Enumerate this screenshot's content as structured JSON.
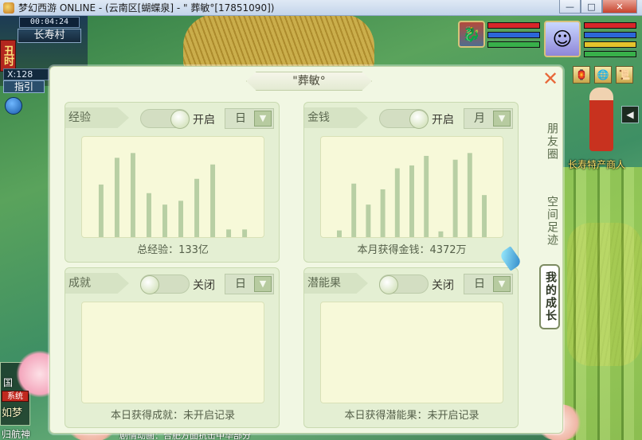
{
  "window": {
    "title": "梦幻西游 ONLINE - (云南区[蝴蝶泉] - \" 葬敏°[17851090])",
    "controls": [
      "—",
      "□",
      "✕"
    ]
  },
  "hud": {
    "time": "00:04:24",
    "location": "长寿村",
    "shichen": "丑时",
    "coord": "X:128",
    "guide": "指引",
    "npc_label": "长寿特产商人",
    "world_channel": "国",
    "system_tag": "系统",
    "chat_line1": "如梦",
    "chat_line2": "归航神",
    "chat_line3": "剧情动画：合肥方面抗击中华部分"
  },
  "panel": {
    "title": "\"葬敏°",
    "close_icon": "close-icon",
    "side_tabs": [
      {
        "label": "朋友圈",
        "active": false
      },
      {
        "label": "空间足迹",
        "active": false
      },
      {
        "label": "我的成长",
        "active": true
      }
    ],
    "cards": [
      {
        "tag": "经验",
        "toggle_state": "on",
        "toggle_label": "开启",
        "period": "日",
        "caption": "总经验：133亿",
        "bars": [
          0.55,
          0.83,
          0.88,
          0.46,
          0.34,
          0.38,
          0.61,
          0.76,
          0.08,
          0.08
        ]
      },
      {
        "tag": "金钱",
        "toggle_state": "on",
        "toggle_label": "开启",
        "period": "月",
        "caption": "本月获得金钱：4372万",
        "bars": [
          0.07,
          0.56,
          0.34,
          0.5,
          0.72,
          0.75,
          0.85,
          0.06,
          0.81,
          0.88,
          0.44
        ]
      },
      {
        "tag": "成就",
        "toggle_state": "off",
        "toggle_label": "关闭",
        "period": "日",
        "caption": "本日获得成就：未开启记录",
        "bars": []
      },
      {
        "tag": "潜能果",
        "toggle_state": "off",
        "toggle_label": "关闭",
        "period": "日",
        "caption": "本日获得潜能果：未开启记录",
        "bars": []
      }
    ]
  },
  "colors": {
    "panel_bg": "#f1f7e3",
    "card_bg": "#e4efd3",
    "chart_bg": "#f7f9d9",
    "bar_color": "#b8cfa4",
    "close_color": "#e8683a"
  }
}
